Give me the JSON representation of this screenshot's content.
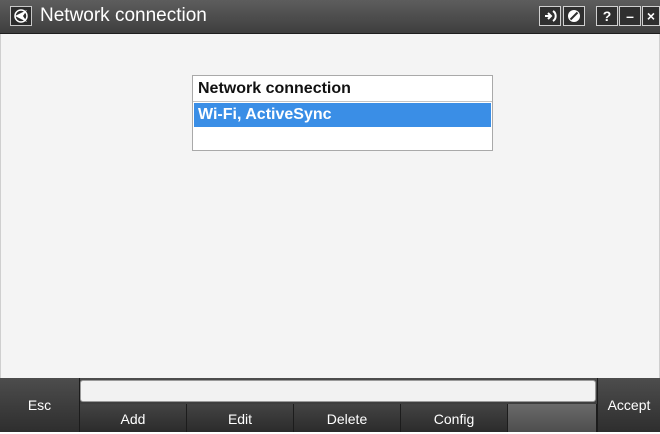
{
  "window": {
    "title": "Network connection",
    "icons": [
      "app-logo-icon",
      "signal-icon",
      "no-entry-icon"
    ],
    "help_label": "?",
    "minimize_label": "–",
    "close_label": "×"
  },
  "list": {
    "header": "Network connection",
    "items": [
      {
        "label": "Wi-Fi,  ActiveSync",
        "selected": true
      }
    ]
  },
  "command_input": {
    "value": ""
  },
  "bottom": {
    "esc_label": "Esc",
    "accept_label": "Accept",
    "softkeys": [
      "Add",
      "Edit",
      "Delete",
      "Config",
      ""
    ]
  },
  "colors": {
    "selection": "#3a8ee6",
    "titlebar": "#4a4a4a",
    "background": "#f4f4f4"
  }
}
